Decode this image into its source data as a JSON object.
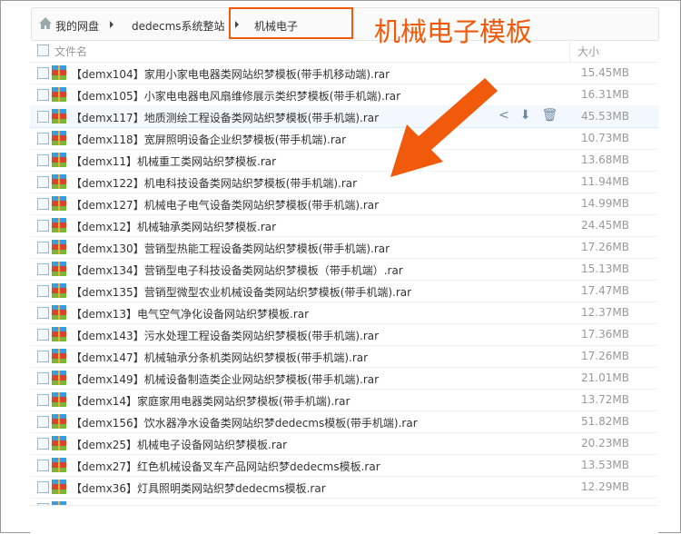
{
  "breadcrumb": [
    "我的网盘",
    "dedecms系统整站",
    "机械电子"
  ],
  "callout": "机械电子模板",
  "header": {
    "name": "文件名",
    "size": "大小"
  },
  "files": [
    {
      "name": "【demx104】家用小家电电器类网站织梦模板(带手机移动端).rar",
      "size": "15.45MB"
    },
    {
      "name": "【demx105】小家电电器电风扇维修展示类织梦模板(带手机端).rar",
      "size": "16.31MB"
    },
    {
      "name": "【demx117】地质测绘工程设备类网站织梦模板(带手机端).rar",
      "size": "45.53MB"
    },
    {
      "name": "【demx118】宽屏照明设备企业织梦模板(带手机端).rar",
      "size": "10.73MB"
    },
    {
      "name": "【demx11】机械重工类网站织梦模板.rar",
      "size": "13.68MB"
    },
    {
      "name": "【demx122】机电科技设备类网站织梦模板(带手机端).rar",
      "size": "11.94MB"
    },
    {
      "name": "【demx127】机械电子电气设备类网站织梦模板(带手机端).rar",
      "size": "14.99MB"
    },
    {
      "name": "【demx12】机械轴承类网站织梦模板.rar",
      "size": "24.45MB"
    },
    {
      "name": "【demx130】营销型热能工程设备类网站织梦模板(带手机端).rar",
      "size": "17.26MB"
    },
    {
      "name": "【demx134】营销型电子科技设备类网站织梦模板（带手机端）.rar",
      "size": "15.13MB"
    },
    {
      "name": "【demx135】营销型微型农业机械设备类网站织梦模板(带手机端).rar",
      "size": "17.47MB"
    },
    {
      "name": "【demx13】电气空气净化设备网站织梦模板.rar",
      "size": "12.37MB"
    },
    {
      "name": "【demx143】污水处理工程设备类网站织梦模板(带手机端).rar",
      "size": "17.36MB"
    },
    {
      "name": "【demx147】机械轴承分条机类网站织梦模板(带手机端).rar",
      "size": "17.26MB"
    },
    {
      "name": "【demx149】机械设备制造类企业网站织梦模板(带手机端).rar",
      "size": "21.01MB"
    },
    {
      "name": "【demx14】家庭家用电器类网站织梦模板(带手机端).rar",
      "size": "13.72MB"
    },
    {
      "name": "【demx156】饮水器净水设备类网站织梦dedecms模板(带手机端).rar",
      "size": "51.82MB"
    },
    {
      "name": "【demx25】机械电子设备网站织梦模板.rar",
      "size": "20.23MB"
    },
    {
      "name": "【demx27】红色机械设备叉车产品网站织梦dedecms模板.rar",
      "size": "13.53MB"
    },
    {
      "name": "【demx36】灯具照明类网站织梦dedecms模板.rar",
      "size": "12.29MB"
    }
  ],
  "colors": {
    "accent": "#f05a0a"
  }
}
